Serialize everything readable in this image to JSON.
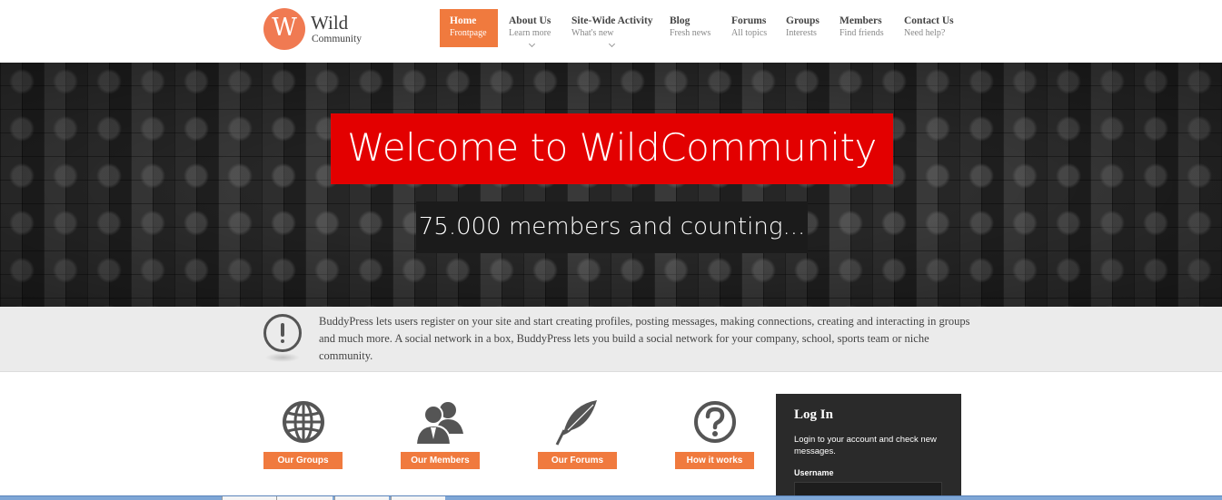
{
  "brand": {
    "logo_letter": "W",
    "name": "Wild",
    "tagline": "Community"
  },
  "nav": [
    {
      "title": "Home",
      "sub": "Frontpage",
      "active": true
    },
    {
      "title": "About Us",
      "sub": "Learn more"
    },
    {
      "title": "Site-Wide Activity",
      "sub": "What's new"
    },
    {
      "title": "Blog",
      "sub": "Fresh news"
    },
    {
      "title": "Forums",
      "sub": "All topics"
    },
    {
      "title": "Groups",
      "sub": "Interests"
    },
    {
      "title": "Members",
      "sub": "Find friends"
    },
    {
      "title": "Contact Us",
      "sub": "Need help?"
    }
  ],
  "hero": {
    "title": "Welcome to WildCommunity",
    "subtitle": "75.000 members and counting..."
  },
  "notice": {
    "icon": "exclamation-icon",
    "text": "BuddyPress lets users register on your site and start creating profiles, posting messages, making connections, creating and interacting in groups and much more. A social network in a box, BuddyPress lets you build a social network for your company, school, sports team or niche community."
  },
  "features": [
    {
      "icon": "globe-icon",
      "label": "Our Groups"
    },
    {
      "icon": "members-icon",
      "label": "Our Members"
    },
    {
      "icon": "feather-icon",
      "label": "Our Forums"
    },
    {
      "icon": "question-icon",
      "label": "How it works"
    }
  ],
  "login": {
    "title": "Log In",
    "description": "Login to your account and check new messages.",
    "username_label": "Username"
  },
  "colors": {
    "accent": "#f07a3e",
    "hero_red": "#e30000",
    "login_bg": "#2a2a2a"
  }
}
